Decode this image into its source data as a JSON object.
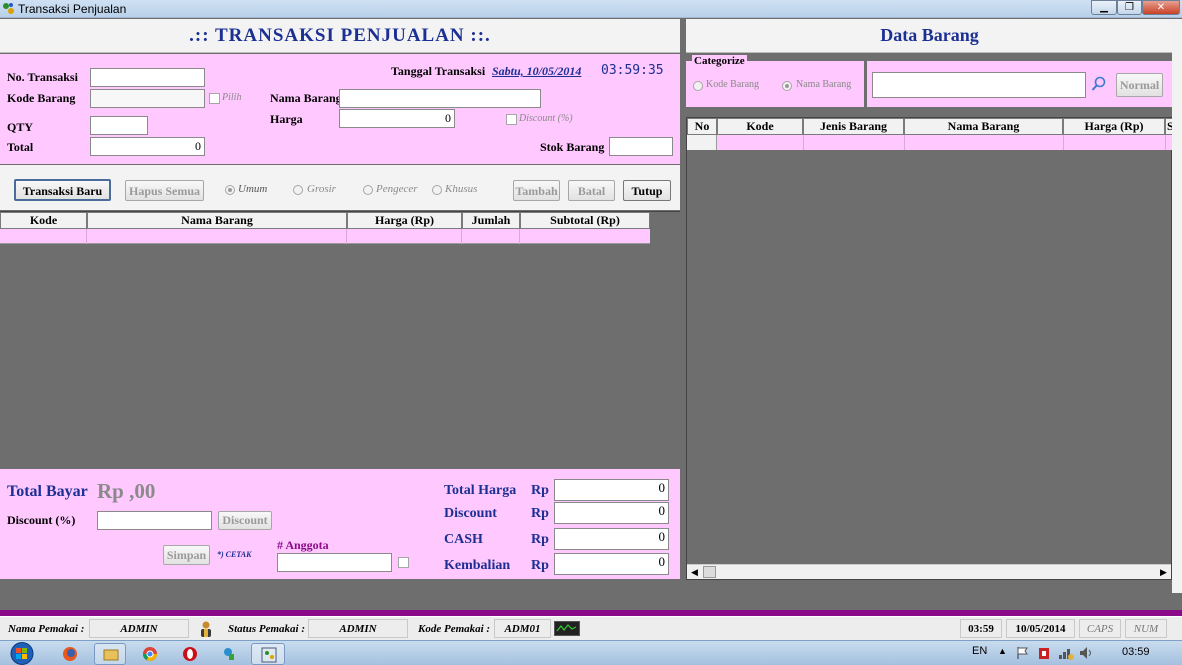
{
  "window": {
    "title": "Transaksi Penjualan",
    "btn_min": "▁",
    "btn_max": "❐",
    "btn_close": "✕"
  },
  "left": {
    "title": ".:: TRANSAKSI PENJUALAN ::.",
    "labels": {
      "no_transaksi": "No. Transaksi",
      "kode_barang": "Kode Barang",
      "qty": "QTY",
      "total": "Total",
      "nama_barang": "Nama Barang",
      "harga": "Harga",
      "tanggal": "Tanggal Transaksi",
      "stok": "Stok Barang",
      "pilih": "Pilih",
      "discount_pct": "Discount (%)"
    },
    "values": {
      "no_transaksi": "",
      "kode_barang": "",
      "qty": "",
      "total": "0",
      "nama_barang": "",
      "harga": "0",
      "stok": "",
      "date": "Sabtu, 10/05/2014",
      "time": "03:59:35"
    },
    "buttons": {
      "transaksi_baru": "Transaksi Baru",
      "hapus_semua": "Hapus Semua",
      "tambah": "Tambah",
      "batal": "Batal",
      "tutup": "Tutup"
    },
    "price_types": [
      "Umum",
      "Grosir",
      "Pengecer",
      "Khusus"
    ],
    "selected_price_type": "Umum",
    "table_headers": [
      "Kode",
      "Nama Barang",
      "Harga (Rp)",
      "Jumlah",
      "Subtotal (Rp)"
    ]
  },
  "bottom": {
    "total_bayar_label": "Total Bayar",
    "total_bayar_value": "Rp ,00",
    "discount_label": "Discount (%)",
    "discount_value": "",
    "discount_btn": "Discount",
    "simpan_btn": "Simpan",
    "cetak": "*) CETAK",
    "anggota_label": "# Anggota",
    "anggota_value": "",
    "summary": [
      {
        "label": "Total Harga",
        "cur": "Rp",
        "value": "0"
      },
      {
        "label": "Discount",
        "cur": "Rp",
        "value": "0"
      },
      {
        "label": "CASH",
        "cur": "Rp",
        "value": "0"
      },
      {
        "label": "Kembalian",
        "cur": "Rp",
        "value": "0"
      }
    ]
  },
  "right": {
    "title": "Data Barang",
    "categorize": "Categorize",
    "options": [
      "Kode Barang",
      "Nama Barang"
    ],
    "selected_option": "Nama Barang",
    "search_value": "",
    "normal_btn": "Normal",
    "table_headers": [
      "No",
      "Kode",
      "Jenis Barang",
      "Nama Barang",
      "Harga (Rp)",
      "S"
    ]
  },
  "statusbar": {
    "nama_pemakai_label": "Nama Pemakai :",
    "nama_pemakai": "ADMIN",
    "status_pemakai_label": "Status Pemakai :",
    "status_pemakai": "ADMIN",
    "kode_pemakai_label": "Kode Pemakai :",
    "kode_pemakai": "ADM01",
    "time": "03:59",
    "date": "10/05/2014",
    "caps": "CAPS",
    "num": "NUM"
  },
  "taskbar": {
    "lang": "EN",
    "clock": "03:59"
  },
  "icons": [
    "app-icon",
    "search-icon",
    "user-icon",
    "monitor-icon",
    "windows-start-icon",
    "firefox-icon",
    "explorer-icon",
    "chrome-icon",
    "opera-icon",
    "app2-icon",
    "app3-icon"
  ],
  "colors": {
    "pink": "#ffc8ff",
    "blue": "#1c2f93",
    "gray": "#6e6e6e",
    "purple": "#8a0a8a"
  }
}
